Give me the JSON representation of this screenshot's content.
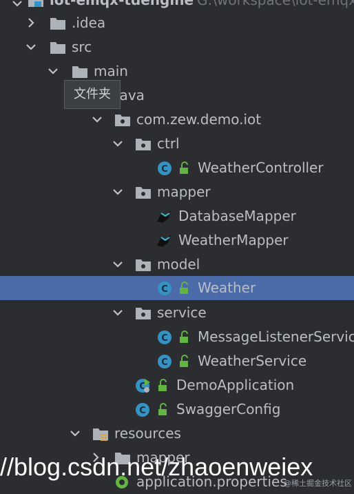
{
  "project": {
    "name": "iot-emqx-tdengine",
    "path": "G:\\workspace\\iot-emqx"
  },
  "tree": {
    "idea": ".idea",
    "src": "src",
    "main": "main",
    "java": "java",
    "package": "com.zew.demo.iot",
    "ctrl": "ctrl",
    "weather_controller": "WeatherController",
    "mapper": "mapper",
    "database_mapper": "DatabaseMapper",
    "weather_mapper": "WeatherMapper",
    "model": "model",
    "weather": "Weather",
    "service": "service",
    "message_listener_service": "MessageListenerService",
    "weather_service": "WeatherService",
    "demo_application": "DemoApplication",
    "swagger_config": "SwaggerConfig",
    "resources": "resources",
    "res_mapper": "mapper",
    "application_properties": "application.properties"
  },
  "tooltip": {
    "text": "文件夹"
  },
  "watermark": {
    "url": "//blog.csdn.net/zhaoenweiex",
    "small": "@稀土掘金技术社区"
  },
  "colors": {
    "background": "#2b2d30",
    "selection": "#4a6aa8",
    "folder": "#aeb3b9",
    "class_icon": "#3592c4",
    "access_green": "#62b543"
  }
}
